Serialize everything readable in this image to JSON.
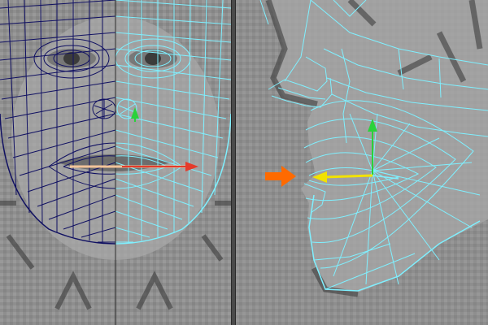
{
  "app": {
    "accent_colors": {
      "wire_left": "#101062",
      "wire_right": "#7ff0ff",
      "axis_x": "#e53a2a",
      "axis_y": "#29d23a",
      "axis_z": "#f2e200",
      "callout_arrow": "#ff6a00"
    }
  },
  "viewports": {
    "front": {
      "name": "front",
      "label": ""
    },
    "side": {
      "name": "side",
      "label": ""
    }
  },
  "icons": {
    "move_manipulator": "move-manipulator-icon",
    "callout_arrow": "orange-arrow-icon"
  }
}
